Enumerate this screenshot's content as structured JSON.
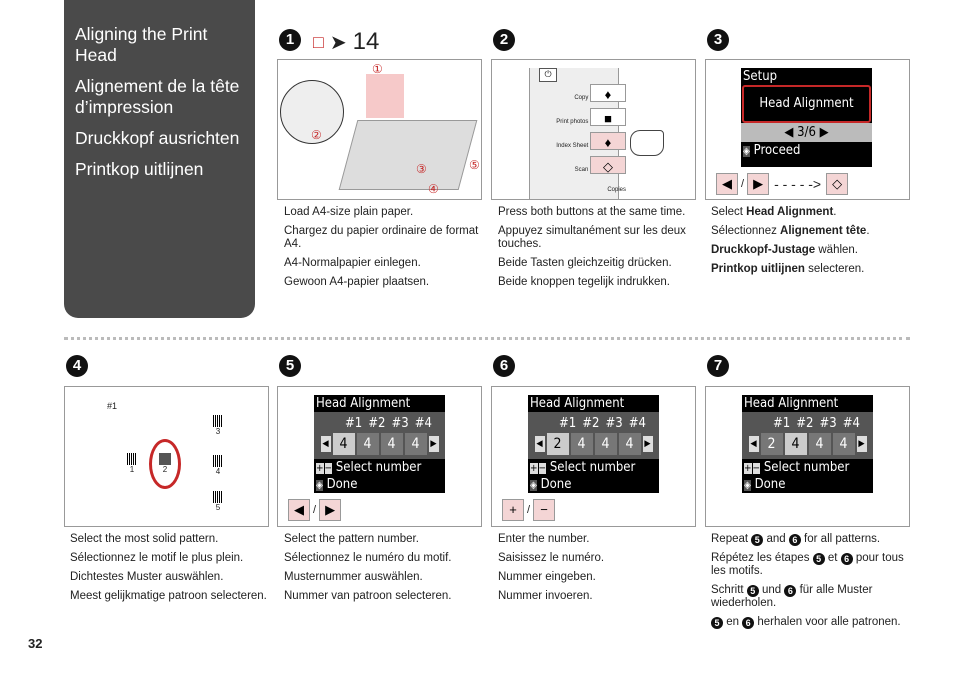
{
  "sidebar": {
    "titles": [
      "Aligning the Print Head",
      "Alignement de la tête d’impression",
      "Druckkopf ausrichten",
      "Printkop uitlijnen"
    ]
  },
  "steps": {
    "n1": "1",
    "n2": "2",
    "n3": "3",
    "n4": "4",
    "n5": "5",
    "n6": "6",
    "n7": "7"
  },
  "step1": {
    "ref_icon": "book-icon",
    "arrow_icon": "arrow-right-icon",
    "ref_page": "14",
    "callouts": [
      "①",
      "②",
      "③",
      "④",
      "⑤"
    ],
    "texts": [
      "Load A4-size plain paper.",
      "Chargez du papier ordinaire de format A4.",
      "A4-Normalpapier einlegen.",
      "Gewoon A4-papier plaatsen."
    ]
  },
  "step2": {
    "buttons": [
      "Copy",
      "Print photos",
      "Index Sheet",
      "Scan",
      "Copies"
    ],
    "texts": [
      "Press both buttons at the same time.",
      "Appuyez simultanément sur les deux touches.",
      "Beide Tasten gleichzeitig drücken.",
      "Beide knoppen tegelijk indrukken."
    ]
  },
  "step3": {
    "lcd_title": "Setup",
    "lcd_item": "Head Alignment",
    "lcd_page": "3/6",
    "lcd_proceed": "Proceed",
    "sep": "/",
    "t1a": "Select ",
    "t1b": "Head Alignment",
    "t1c": ".",
    "t2a": "Sélectionnez ",
    "t2b": "Alignement tête",
    "t2c": ".",
    "t3a": "Druckkopf-Justage",
    "t3b": " wählen.",
    "t4a": "Printkop uitlijnen",
    "t4b": " selecteren."
  },
  "step4": {
    "label": "#1",
    "patterns": [
      "1",
      "2",
      "3",
      "4",
      "5"
    ],
    "texts": [
      "Select the most solid pattern.",
      "Sélectionnez le motif le plus plein.",
      "Dichtestes Muster auswählen.",
      "Meest gelijkmatige patroon selecteren."
    ]
  },
  "lcd": {
    "title": "Head Alignment",
    "headers": [
      "#1",
      "#2",
      "#3",
      "#4"
    ],
    "select": "Select number",
    "done": "Done"
  },
  "step5": {
    "values": [
      "4",
      "4",
      "4",
      "4"
    ],
    "selected": 0,
    "sep": "/",
    "texts": [
      "Select the pattern number.",
      "Sélectionnez le numéro du motif.",
      "Musternummer auswählen.",
      "Nummer van patroon selecteren."
    ]
  },
  "step6": {
    "values": [
      "2",
      "4",
      "4",
      "4"
    ],
    "selected": 0,
    "plus": "+",
    "minus": "−",
    "sep": "/",
    "texts": [
      "Enter the number.",
      "Saisissez le numéro.",
      "Nummer eingeben.",
      "Nummer invoeren."
    ]
  },
  "step7": {
    "values": [
      "2",
      "4",
      "4",
      "4"
    ],
    "selected": 1,
    "a1": "Repeat ",
    "a2": " and ",
    "a3": " for all patterns.",
    "b1": "Répétez les étapes ",
    "b2": " et ",
    "b3": " pour tous les motifs.",
    "c1": "Schritt ",
    "c2": " und ",
    "c3": " für alle Muster wiederholen.",
    "d2": " en ",
    "d3": " herhalen voor alle patronen."
  },
  "page_number": "32",
  "colors": {
    "sidebar": "#4a4a4a",
    "button_pink": "#f4d5d5",
    "highlight_red": "#c62828"
  }
}
